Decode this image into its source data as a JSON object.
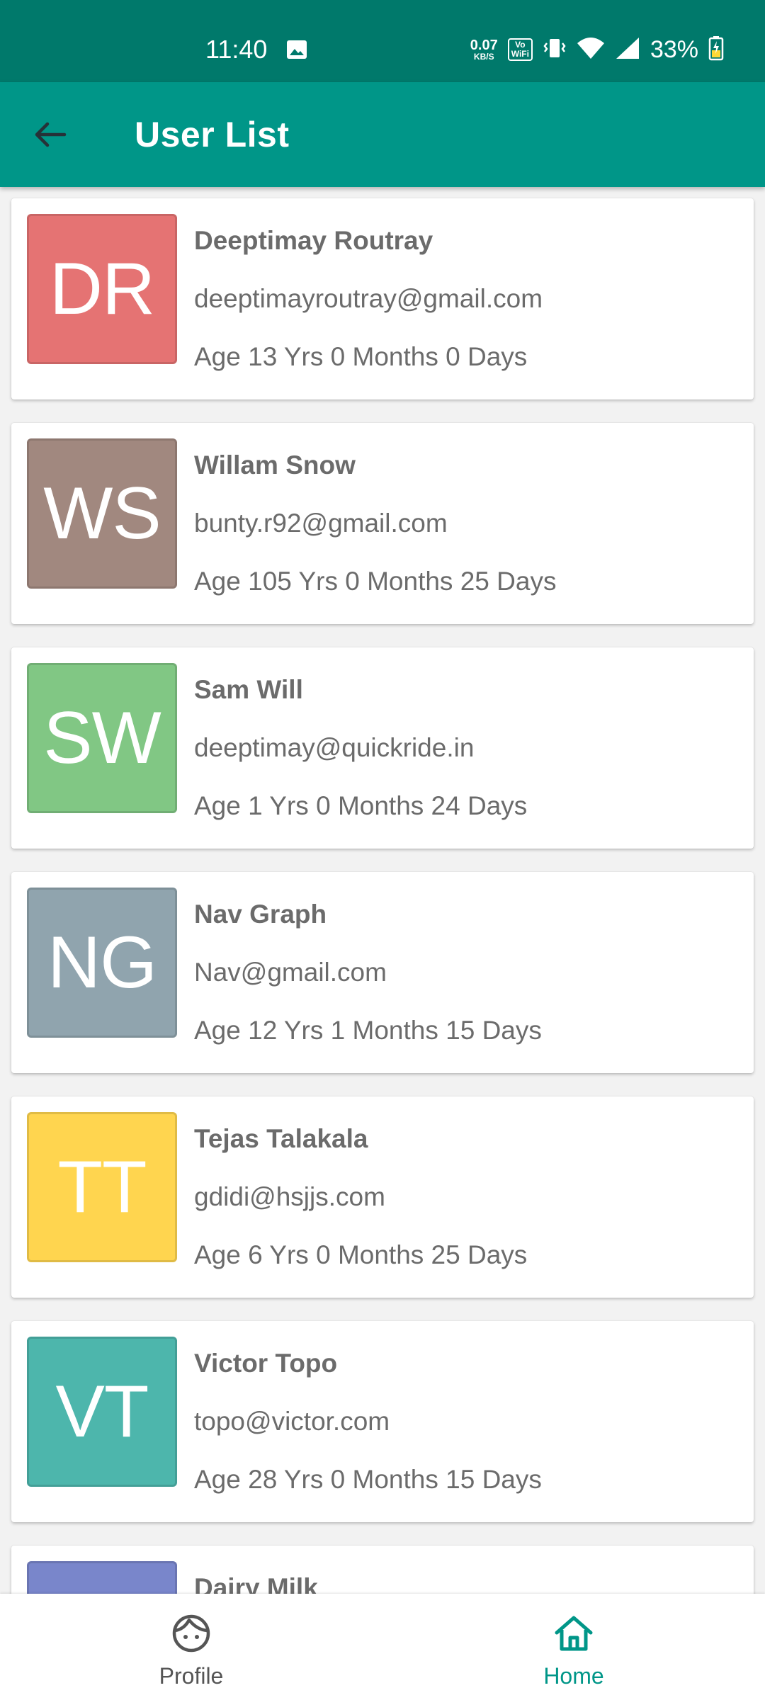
{
  "status_bar": {
    "time": "11:40",
    "net_speed_value": "0.07",
    "net_speed_unit": "KB/S",
    "vowifi_top": "Vo",
    "vowifi_bottom": "WiFi",
    "battery": "33%"
  },
  "app_bar": {
    "title": "User List",
    "background": "#009688",
    "status_background": "#00796b"
  },
  "users": [
    {
      "initials": "DR",
      "name": "Deeptimay Routray",
      "email": "deeptimayroutray@gmail.com",
      "age": "Age 13 Yrs 0 Months 0 Days",
      "color": "#e57373"
    },
    {
      "initials": "WS",
      "name": "Willam Snow",
      "email": "bunty.r92@gmail.com",
      "age": "Age 105 Yrs 0 Months 25 Days",
      "color": "#a1887f"
    },
    {
      "initials": "SW",
      "name": "Sam Will",
      "email": "deeptimay@quickride.in",
      "age": "Age 1 Yrs 0 Months 24 Days",
      "color": "#81c784"
    },
    {
      "initials": "NG",
      "name": "Nav Graph",
      "email": "Nav@gmail.com",
      "age": "Age 12 Yrs 1 Months 15 Days",
      "color": "#90a4ae"
    },
    {
      "initials": "TT",
      "name": "Tejas Talakala",
      "email": "gdidi@hsjjs.com",
      "age": "Age 6 Yrs 0 Months 25 Days",
      "color": "#ffd54f"
    },
    {
      "initials": "VT",
      "name": "Victor Topo",
      "email": "topo@victor.com",
      "age": "Age 28 Yrs 0 Months 15 Days",
      "color": "#4db6ac"
    },
    {
      "initials": "",
      "name": "Dairy Milk",
      "email": "",
      "age": "",
      "color": "#7986cb"
    }
  ],
  "bottom_nav": {
    "items": [
      {
        "label": "Profile",
        "icon": "face-icon",
        "active": false,
        "color": "#555555"
      },
      {
        "label": "Home",
        "icon": "home-icon",
        "active": true,
        "color": "#009688"
      }
    ]
  }
}
